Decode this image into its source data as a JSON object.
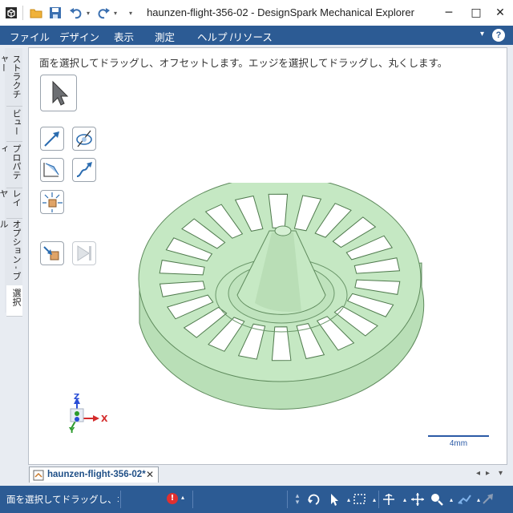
{
  "window": {
    "title": "haunzen-flight-356-02 - DesignSpark Mechanical Explorer",
    "minimize": "─",
    "maximize": "□",
    "close": "✕"
  },
  "quick_access": {
    "icons": [
      "open-folder-icon",
      "save-icon",
      "undo-icon",
      "redo-icon"
    ]
  },
  "menu": {
    "items": [
      "ファイル",
      "デザイン",
      "表示",
      "測定",
      "ヘルプ /リソース"
    ],
    "help_glyph": "?",
    "caret": "▾"
  },
  "side_tabs": [
    "ストラクチャー",
    "ビュー",
    "プロパティ",
    "レイヤ",
    "オプション - ブル",
    "選択"
  ],
  "viewport": {
    "hint": "面を選択してドラッグし、オフセットします。エッジを選択してドラッグし、丸くします。",
    "tools": [
      "select-icon",
      "pull-arrow-icon",
      "revolve-icon",
      "corner-icon",
      "sweep-icon",
      "move-icon",
      "pull-to-icon",
      "play-disabled-icon"
    ],
    "axis_labels": {
      "z": "Z",
      "x": "X",
      "y": "Y"
    },
    "scale_label": "4mm",
    "model_color": "#c5e8c3"
  },
  "doc_tab": {
    "name": "haunzen-flight-356-02*",
    "close": "✕"
  },
  "nav": {
    "left": "◂",
    "right": "▸",
    "down": "▾"
  },
  "status": {
    "message": "面を選択してドラッグし、オ",
    "error_glyph": "!",
    "icons": [
      "scroll-arrows-icon",
      "spin-icon",
      "pointer-icon",
      "selection-box-icon",
      "pan-icon",
      "move-cross-icon",
      "zoom-icon",
      "orient-icon",
      "redo-arrow-icon"
    ]
  }
}
